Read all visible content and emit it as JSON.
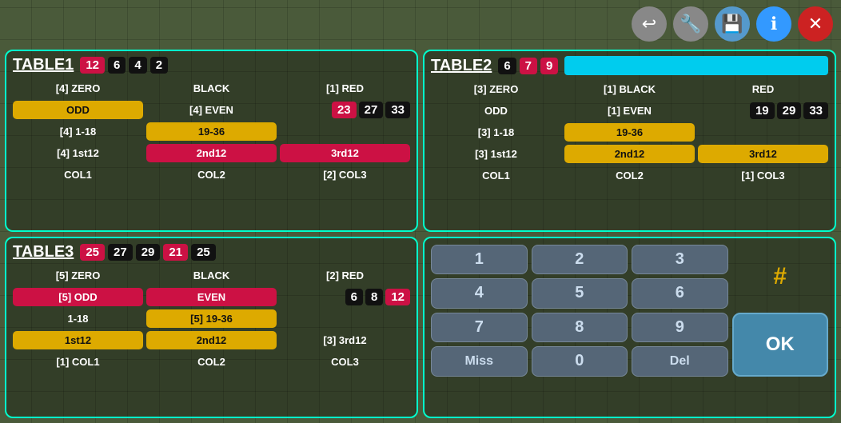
{
  "toolbar": {
    "back_label": "↩",
    "wrench_label": "🔧",
    "save_label": "💾",
    "info_label": "ℹ",
    "close_label": "✕"
  },
  "table1": {
    "title": "TABLE1",
    "header_badges": [
      "12",
      "6",
      "4",
      "2"
    ],
    "header_colors": [
      "crimson",
      "black",
      "black",
      "black"
    ],
    "rows": [
      {
        "cells": [
          "[4] ZERO",
          "BLACK",
          "[1] RED"
        ]
      },
      {
        "cells": [
          "ODD",
          "[4] EVEN",
          ""
        ],
        "badges": [
          "23",
          "27",
          "33"
        ],
        "badge_colors": [
          "crimson",
          "black",
          "black"
        ]
      },
      {
        "cells": [
          "[4] 1-18",
          "19-36",
          ""
        ]
      },
      {
        "cells": [
          "[4] 1st12",
          "2nd12",
          "3rd12"
        ]
      },
      {
        "cells": [
          "COL1",
          "COL2",
          "[2] COL3"
        ]
      }
    ]
  },
  "table2": {
    "title": "TABLE2",
    "header_badges": [
      "6",
      "7",
      "9"
    ],
    "header_colors": [
      "black",
      "crimson",
      "crimson"
    ],
    "rows": [
      {
        "cells": [
          "[3] ZERO",
          "[1] BLACK",
          "RED"
        ]
      },
      {
        "cells": [
          "ODD",
          "[1] EVEN",
          ""
        ],
        "badges": [
          "19",
          "29",
          "33"
        ],
        "badge_colors": [
          "black",
          "black",
          "black"
        ]
      },
      {
        "cells": [
          "[3] 1-18",
          "19-36",
          ""
        ]
      },
      {
        "cells": [
          "[3] 1st12",
          "2nd12",
          "3rd12"
        ]
      },
      {
        "cells": [
          "COL1",
          "COL2",
          "[1] COL3"
        ]
      }
    ]
  },
  "table3": {
    "title": "TABLE3",
    "header_badges": [
      "25",
      "27",
      "29",
      "21",
      "25"
    ],
    "header_colors": [
      "crimson",
      "black",
      "black",
      "crimson",
      "black"
    ],
    "rows": [
      {
        "cells": [
          "[5] ZERO",
          "BLACK",
          "[2] RED"
        ]
      },
      {
        "cells": [
          "[5] ODD",
          "EVEN",
          ""
        ],
        "badges": [
          "6",
          "8",
          "12"
        ],
        "badge_colors": [
          "black",
          "black",
          "crimson"
        ]
      },
      {
        "cells": [
          "1-18",
          "[5] 19-36",
          ""
        ]
      },
      {
        "cells": [
          "1st12",
          "2nd12",
          "[3] 3rd12"
        ]
      },
      {
        "cells": [
          "[1] COL1",
          "COL2",
          "COL3"
        ]
      }
    ]
  },
  "numpad": {
    "buttons": [
      "1",
      "2",
      "3",
      "4",
      "5",
      "6",
      "7",
      "8",
      "9",
      "Miss",
      "0",
      "Del"
    ],
    "hash": "#",
    "ok": "OK"
  }
}
